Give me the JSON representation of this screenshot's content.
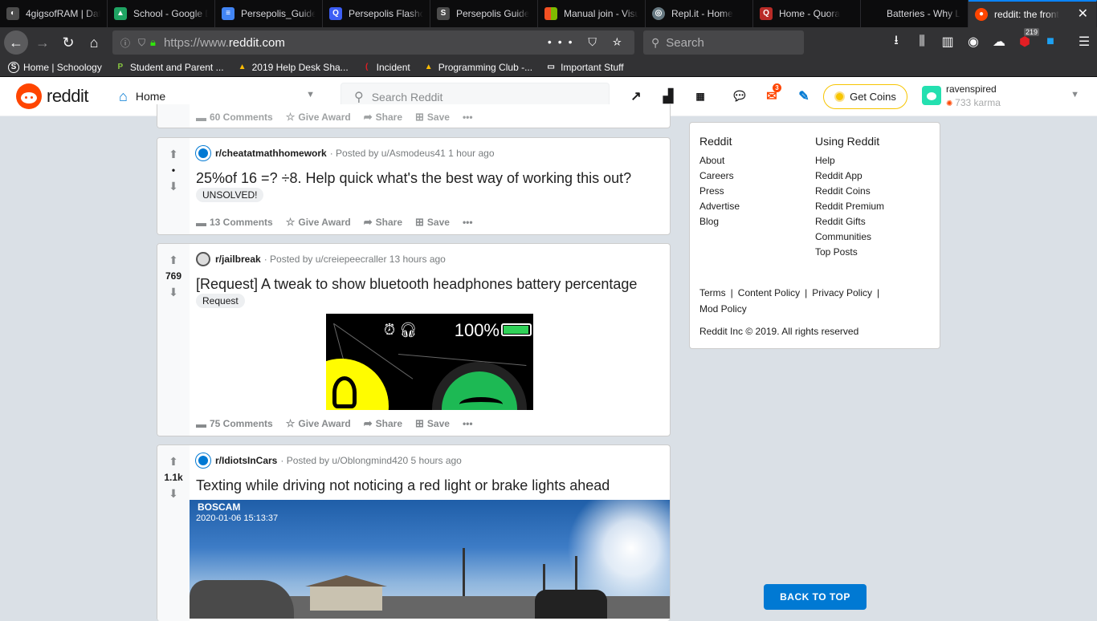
{
  "browser": {
    "tabs": [
      {
        "title": "4gigsofRAM | Dat",
        "icon_color": "#4c4c4c"
      },
      {
        "title": "School - Google D",
        "icon_color": "#1fa463"
      },
      {
        "title": "Persepolis_Guide",
        "icon_color": "#4285f4"
      },
      {
        "title": "Persepolis Flashc",
        "icon_color": "#3c5ef4"
      },
      {
        "title": "Persepolis Guide",
        "icon_color": "#4c4c4c"
      },
      {
        "title": "Manual join - Visu",
        "icon_color": "#f25022"
      },
      {
        "title": "Repl.it - Home",
        "icon_color": "#667881"
      },
      {
        "title": "Home - Quora",
        "icon_color": "#b92b27"
      },
      {
        "title": "Batteries - Why L",
        "icon_color": "#999999"
      },
      {
        "title": "reddit: the front",
        "icon_color": "#ff4500",
        "active": true
      }
    ],
    "url_prefix": "https://www.",
    "url_domain": "reddit.com",
    "search_placeholder": "Search",
    "extension_badge": "219",
    "bookmarks": [
      {
        "label": "Home | Schoology",
        "icon": "S"
      },
      {
        "label": "Student and Parent ...",
        "icon": "P"
      },
      {
        "label": "2019 Help Desk Sha...",
        "icon": "▲"
      },
      {
        "label": "Incident",
        "icon": "("
      },
      {
        "label": "Programming Club -...",
        "icon": "▲"
      },
      {
        "label": "Important Stuff",
        "icon": "▭"
      }
    ]
  },
  "reddit_header": {
    "logo_text": "reddit",
    "feed_label": "Home",
    "search_placeholder": "Search Reddit",
    "mail_count": "3",
    "coins_label": "Get Coins",
    "username": "ravenspired",
    "karma": "733 karma"
  },
  "partial_post": {
    "comments": "60 Comments",
    "award": "Give Award",
    "share": "Share",
    "save": "Save"
  },
  "posts": [
    {
      "subreddit": "r/cheatatmathhomework",
      "posted_by": "· Posted by u/Asmodeus41 1 hour ago",
      "score": "•",
      "title": "25%of 16 =? ÷8. Help quick what's the best way of working this out?",
      "flair": "UNSOLVED!",
      "comments": "13 Comments",
      "award": "Give Award",
      "share": "Share",
      "save": "Save"
    },
    {
      "subreddit": "r/jailbreak",
      "posted_by": "· Posted by u/creiepeecraller 13 hours ago",
      "score": "769",
      "title": "[Request] A tweak to show bluetooth headphones battery percentage",
      "flair": "Request",
      "image_status_text": "100%",
      "comments": "75 Comments",
      "award": "Give Award",
      "share": "Share",
      "save": "Save"
    },
    {
      "subreddit": "r/IdiotsInCars",
      "posted_by": "· Posted by u/Oblongmind420 5 hours ago",
      "score": "1.1k",
      "title": "Texting while driving not noticing a red light or brake lights ahead",
      "cam_brand": "BOSCAM",
      "cam_timestamp": "2020-01-06  15:13:37"
    }
  ],
  "sidebar": {
    "col1_heading": "Reddit",
    "col1_links": [
      "About",
      "Careers",
      "Press",
      "Advertise",
      "Blog"
    ],
    "col2_heading": "Using Reddit",
    "col2_links": [
      "Help",
      "Reddit App",
      "Reddit Coins",
      "Reddit Premium",
      "Reddit Gifts",
      "Communities",
      "Top Posts"
    ],
    "legal": {
      "terms": "Terms",
      "content_policy": "Content Policy",
      "privacy_policy": "Privacy Policy",
      "mod_policy": "Mod Policy"
    },
    "copyright": "Reddit Inc © 2019. All rights reserved"
  },
  "back_to_top": "BACK TO TOP",
  "colors": {
    "reddit_orange": "#ff4500",
    "reddit_blue": "#0079d3",
    "coin_gold": "#f7c500",
    "page_bg": "#dae0e6"
  }
}
